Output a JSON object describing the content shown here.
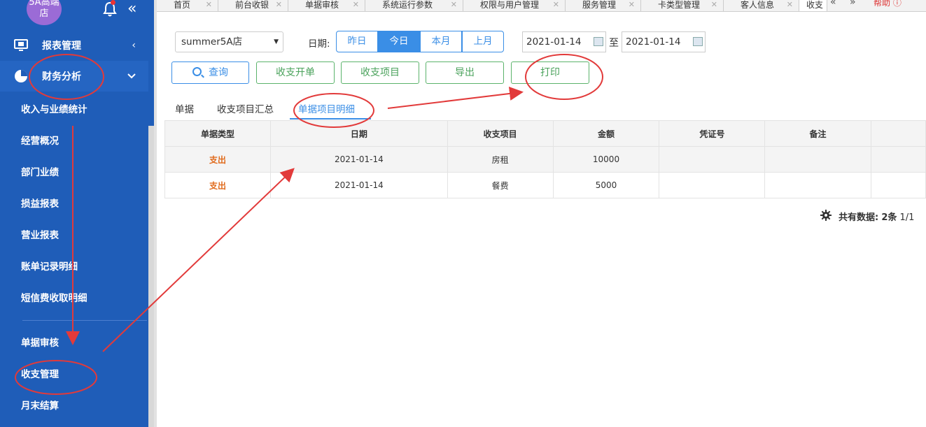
{
  "sidebar": {
    "store_name": "5A高端店",
    "groups": [
      {
        "label": "报表管理",
        "arrow": "‹"
      },
      {
        "label": "财务分析",
        "arrow": "⌄"
      }
    ],
    "items": [
      {
        "label": "收入与业绩统计"
      },
      {
        "label": "经营概况"
      },
      {
        "label": "部门业绩"
      },
      {
        "label": "损益报表"
      },
      {
        "label": "营业报表"
      },
      {
        "label": "账单记录明细"
      },
      {
        "label": "短信费收取明细"
      },
      {
        "label": "单据审核"
      },
      {
        "label": "收支管理"
      },
      {
        "label": "月末结算"
      }
    ]
  },
  "tabs": [
    {
      "label": "首页"
    },
    {
      "label": "前台收银"
    },
    {
      "label": "单据审核"
    },
    {
      "label": "系统运行参数"
    },
    {
      "label": "权限与用户管理"
    },
    {
      "label": "服务管理"
    },
    {
      "label": "卡类型管理"
    },
    {
      "label": "客人信息"
    },
    {
      "label": "收支"
    }
  ],
  "tab_nav": {
    "prev": "«",
    "next": "»",
    "help": "帮助 ⓘ"
  },
  "filters": {
    "store": "summer5A店",
    "date_label": "日期:",
    "ranges": [
      "昨日",
      "今日",
      "本月",
      "上月"
    ],
    "active_range": "今日",
    "start_date": "2021-01-14",
    "to_label": "至",
    "end_date": "2021-01-14"
  },
  "actions": {
    "query": "查询",
    "open_bill": "收支开单",
    "items": "收支项目",
    "export": "导出",
    "print": "打印"
  },
  "subtabs": [
    "单据",
    "收支项目汇总",
    "单据项目明细"
  ],
  "active_subtab": "单据项目明细",
  "table": {
    "headers": [
      "单据类型",
      "日期",
      "收支项目",
      "金额",
      "凭证号",
      "备注"
    ],
    "rows": [
      [
        "支出",
        "2021-01-14",
        "房租",
        "10000",
        "",
        ""
      ],
      [
        "支出",
        "2021-01-14",
        "餐费",
        "5000",
        "",
        ""
      ]
    ]
  },
  "footer": {
    "total_label": "共有数据:",
    "total_count": "2条",
    "page": "1/1"
  },
  "colors": {
    "sidebar": "#1f5db8",
    "accent_blue": "#3a8ee6",
    "button_green": "#4aa25b",
    "expense": "#e06a1b",
    "annotation_red": "#e23a3a"
  }
}
